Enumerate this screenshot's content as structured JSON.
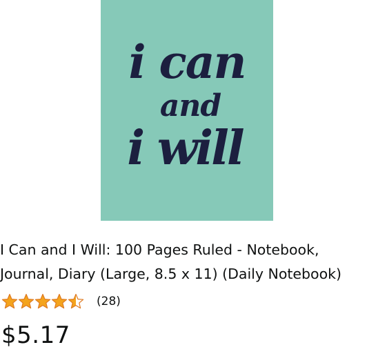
{
  "product": {
    "cover": {
      "background_color": "#86c9b8",
      "ink_color": "#1c1f3f",
      "lines": [
        "i can",
        "and",
        "i will"
      ]
    },
    "title": "I Can and I Will: 100 Pages Ruled - Notebook, Journal, Diary (Large, 8.5 x 11) (Daily Notebook)",
    "rating": {
      "value": 4.5,
      "max": 5,
      "star_color": "#f4a41d",
      "star_outline": "#de7921"
    },
    "review_count": "(28)",
    "price": "$5.17"
  }
}
